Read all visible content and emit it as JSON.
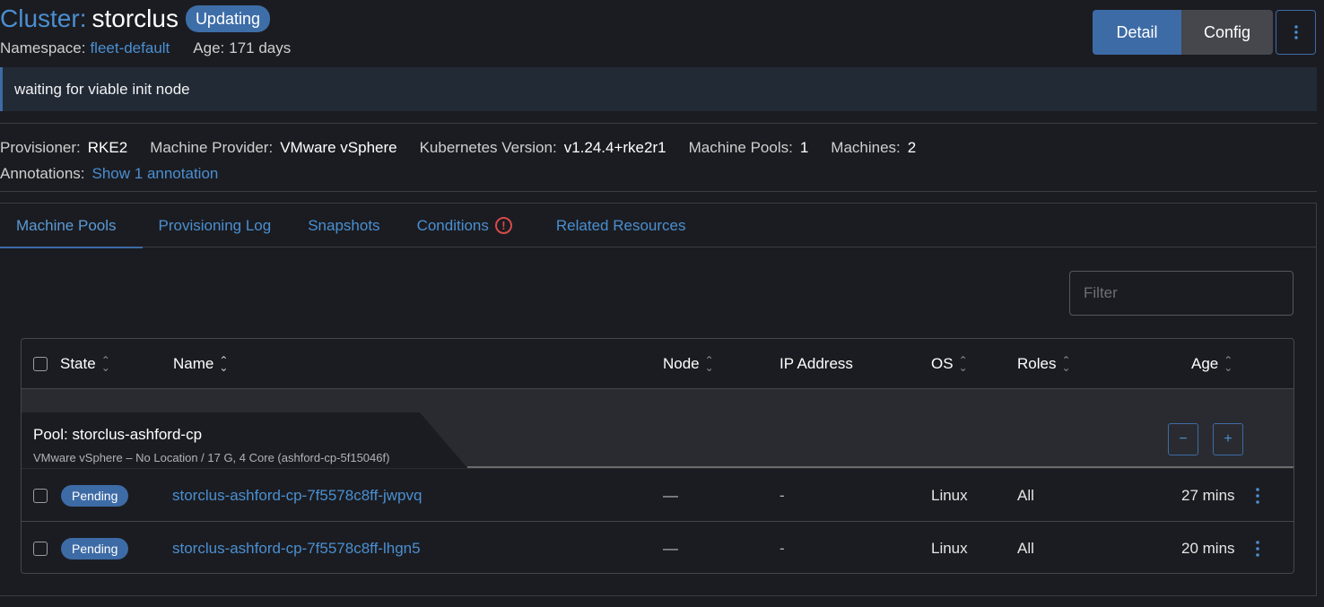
{
  "header": {
    "title_prefix": "Cluster:",
    "cluster_name": "storclus",
    "state_badge": "Updating",
    "namespace_label": "Namespace:",
    "namespace_value": "fleet-default",
    "age_label": "Age:",
    "age_value": "171 days",
    "actions": {
      "detail": "Detail",
      "config": "Config",
      "more_icon": "vertical-dots-icon"
    }
  },
  "banner": {
    "message": "waiting for viable init node"
  },
  "details": {
    "provisioner_label": "Provisioner:",
    "provisioner_value": "RKE2",
    "machine_provider_label": "Machine Provider:",
    "machine_provider_value": "VMware vSphere",
    "k8s_version_label": "Kubernetes Version:",
    "k8s_version_value": "v1.24.4+rke2r1",
    "machine_pools_label": "Machine Pools:",
    "machine_pools_value": "1",
    "machines_label": "Machines:",
    "machines_value": "2",
    "annotations_label": "Annotations:",
    "annotations_link": "Show 1 annotation"
  },
  "tabs": [
    {
      "label": "Machine Pools",
      "active": true
    },
    {
      "label": "Provisioning Log"
    },
    {
      "label": "Snapshots"
    },
    {
      "label": "Conditions",
      "icon": "warning-circle-icon"
    },
    {
      "label": "Related Resources"
    }
  ],
  "filter": {
    "placeholder": "Filter",
    "value": ""
  },
  "table": {
    "columns": [
      "State",
      "Name",
      "Node",
      "IP Address",
      "OS",
      "Roles",
      "Age"
    ],
    "pool": {
      "title": "Pool: storclus-ashford-cp",
      "subtitle": "VMware vSphere – No Location / 17 G, 4 Core (ashford-cp-5f15046f)",
      "scale_down": "−",
      "scale_up": "+"
    },
    "rows": [
      {
        "state": "Pending",
        "name": "storclus-ashford-cp-7f5578c8ff-jwpvq",
        "node": "—",
        "ip": "-",
        "os": "Linux",
        "roles": "All",
        "age": "27 mins"
      },
      {
        "state": "Pending",
        "name": "storclus-ashford-cp-7f5578c8ff-lhgn5",
        "node": "—",
        "ip": "-",
        "os": "Linux",
        "roles": "All",
        "age": "20 mins"
      }
    ]
  },
  "colors": {
    "accent": "#3d6ba6",
    "link": "#4a8fd1",
    "background": "#1b1c21",
    "danger": "#d64a4a"
  }
}
